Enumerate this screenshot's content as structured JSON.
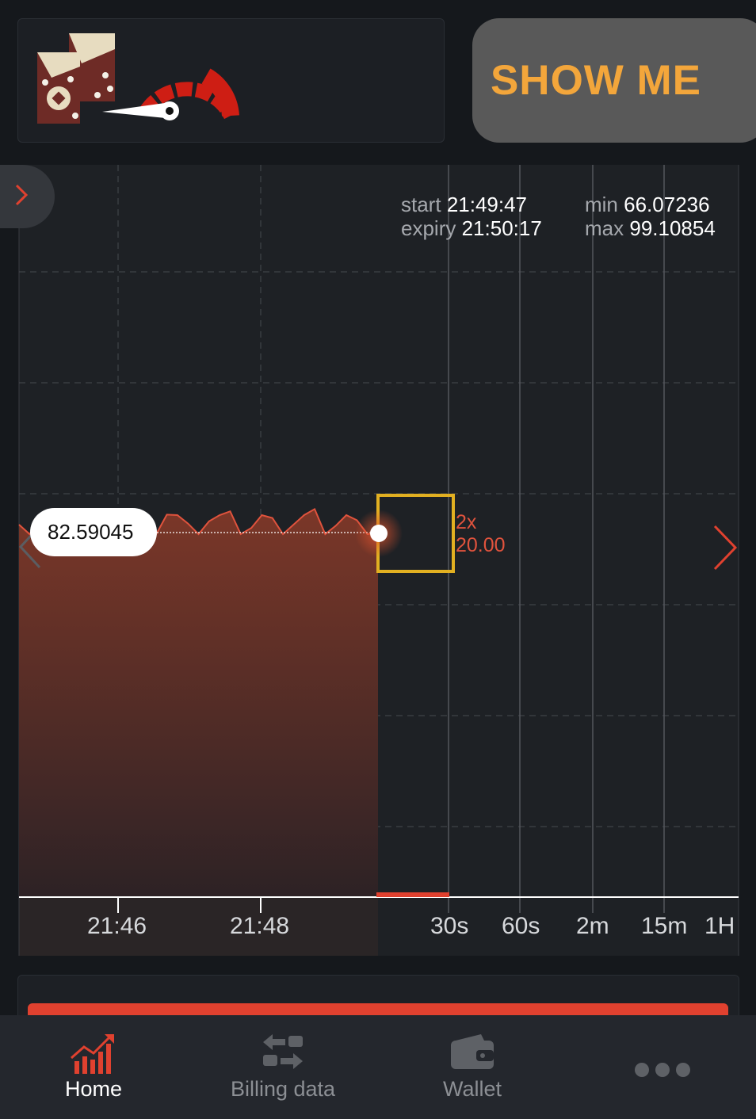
{
  "header": {
    "show_me_label": "SHOW ME",
    "logo_icon": "cards-speedometer-logo-icon"
  },
  "colors": {
    "accent": "#e0412f",
    "gold": "#f3a63b",
    "panel": "#1c1f24",
    "background": "#15181c"
  },
  "chart_info": {
    "start_key": "start",
    "start_value": "21:49:47",
    "expiry_key": "expiry",
    "expiry_value": "21:50:17",
    "min_key": "min",
    "min_value": "66.07236",
    "max_key": "max",
    "max_value": "99.10854"
  },
  "current_price": "82.59045",
  "target": {
    "multiplier": "2x",
    "amount": "20.00"
  },
  "chart_data": {
    "type": "area",
    "x_tick_labels": [
      "21:46",
      "21:48"
    ],
    "price_series_at_current_level": [
      82.6,
      82.9,
      83.4,
      82.5,
      82.8,
      83.1,
      82.4,
      83.5,
      82.7,
      82.9,
      83.8,
      82.3,
      83.2,
      82.6,
      84.0,
      82.5,
      83.0,
      82.6
    ]
  },
  "timeframes": [
    "30s",
    "60s",
    "2m",
    "15m",
    "1H"
  ],
  "nav": {
    "items": [
      {
        "label": "Home",
        "icon": "chart-growth-icon",
        "active": true
      },
      {
        "label": "Billing data",
        "icon": "swap-arrows-icon",
        "active": false
      },
      {
        "label": "Wallet",
        "icon": "wallet-icon",
        "active": false
      },
      {
        "label": "",
        "icon": "more-dots-icon",
        "active": false
      }
    ]
  }
}
